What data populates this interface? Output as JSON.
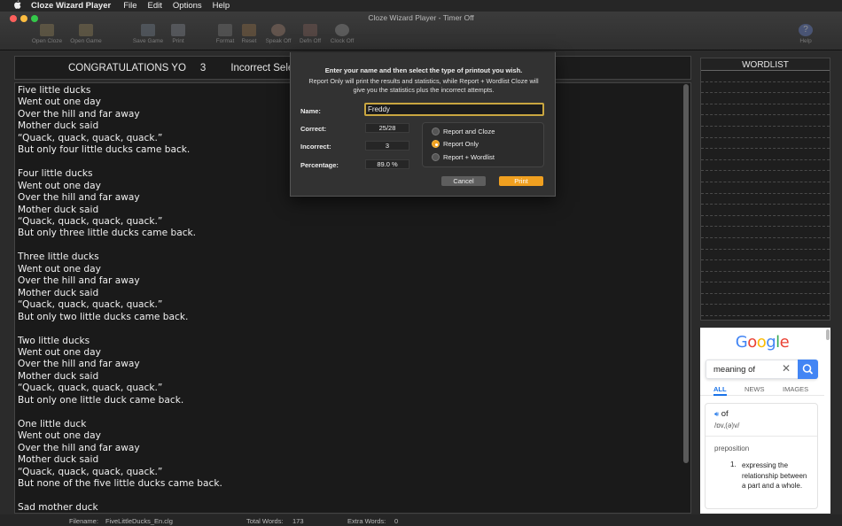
{
  "menubar": {
    "apple": "",
    "app": "Cloze Wizard Player",
    "items": [
      "File",
      "Edit",
      "Options",
      "Help"
    ]
  },
  "window": {
    "title": "Cloze Wizard Player - Timer Off"
  },
  "toolbar": {
    "open_cloze": "Open Cloze",
    "open_game": "Open Game",
    "save_game": "Save Game",
    "print": "Print",
    "format": "Format",
    "reset": "Reset",
    "speak": "Speak Off",
    "defn": "Defn Off",
    "clock": "Clock Off",
    "help": "Help"
  },
  "header": {
    "congrats": "CONGRATULATIONS YO",
    "count": "3",
    "incorrect": "Incorrect Selec"
  },
  "poem": "Five little ducks\nWent out one day\nOver the hill and far away\nMother duck said\n“Quack, quack, quack, quack.”\nBut only four little ducks came back.\n\nFour little ducks\nWent out one day\nOver the hill and far away\nMother duck said\n“Quack, quack, quack, quack.”\nBut only three little ducks came back.\n\nThree little ducks\nWent out one day\nOver the hill and far away\nMother duck said\n“Quack, quack, quack, quack.”\nBut only two little ducks came back.\n\nTwo little ducks\nWent out one day\nOver the hill and far away\nMother duck said\n“Quack, quack, quack, quack.”\nBut only one little duck came back.\n\nOne little duck\nWent out one day\nOver the hill and far away\nMother duck said\n“Quack, quack, quack, quack.”\nBut none of the five little ducks came back.\n\nSad mother duck",
  "wordlist": {
    "title": "WORDLIST"
  },
  "google": {
    "logo": "Google",
    "query": "meaning of",
    "tabs": [
      "ALL",
      "NEWS",
      "IMAGES"
    ],
    "word": "of",
    "phonetic": "/ɒv,(ə)v/",
    "pos": "preposition",
    "num": "1.",
    "definition": "expressing the relationship between a part and a whole."
  },
  "dialog": {
    "instruction": "Enter your name and then select the type of printout you wish.",
    "note": "Report Only will print the results and statistics, while Report + Wordlist Cloze will give you the statistics plus the incorrect attempts.",
    "name_label": "Name:",
    "name_value": "Freddy",
    "correct_label": "Correct:",
    "correct_value": "25/28",
    "incorrect_label": "Incorrect:",
    "incorrect_value": "3",
    "percentage_label": "Percentage:",
    "percentage_value": "89.0 %",
    "options": [
      "Report and Cloze",
      "Report Only",
      "Report + Wordlist"
    ],
    "selected_option": "Report Only",
    "cancel": "Cancel",
    "print": "Print"
  },
  "status": {
    "filename_label": "Filename:",
    "filename": "FiveLittleDucks_En.clg",
    "total_label": "Total Words:",
    "total": "173",
    "extra_label": "Extra Words:",
    "extra": "0"
  },
  "colors": {
    "accent": "#f0a020",
    "close": "#fc605c",
    "minimize": "#fdbc40",
    "zoom": "#34c84a",
    "google_blue": "#4285f4"
  }
}
